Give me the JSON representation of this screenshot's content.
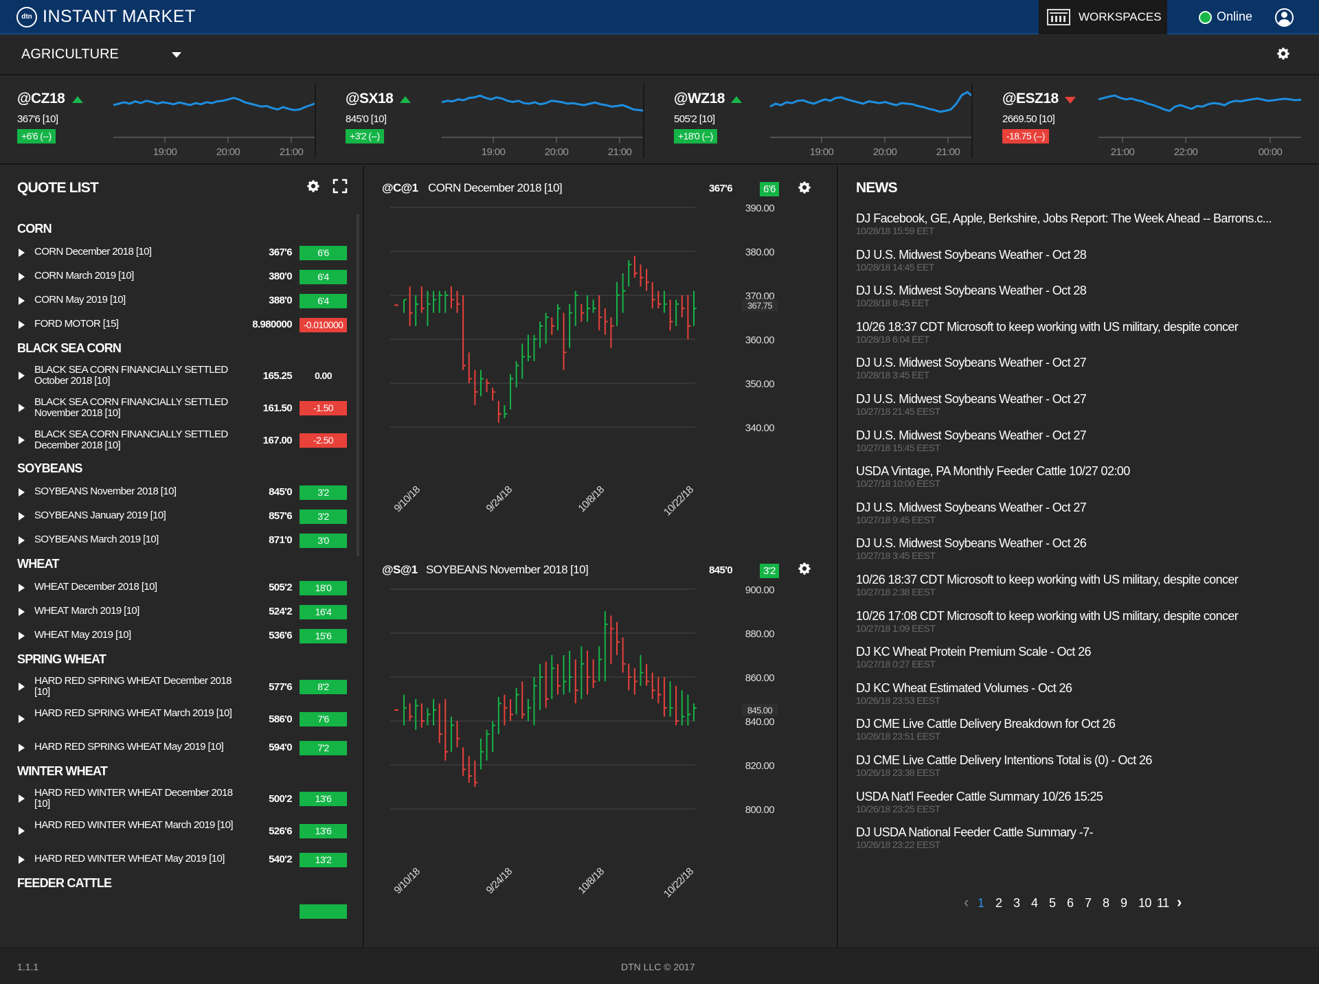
{
  "app": {
    "logo_text": "dtn",
    "title": "INSTANT MARKET"
  },
  "header": {
    "workspaces_label": "WORKSPACES",
    "status_label": "Online",
    "status_color": "#18b64a"
  },
  "workspace": {
    "selected": "AGRICULTURE"
  },
  "ticker": [
    {
      "symbol": "@CZ18",
      "direction": "up",
      "price": "367'6 [10]",
      "change": "+6'6 (--)",
      "change_sign": "pos",
      "times": [
        "19:00",
        "20:00",
        "21:00"
      ],
      "spark": [
        0.55,
        0.5,
        0.45,
        0.5,
        0.42,
        0.48,
        0.4,
        0.44,
        0.5,
        0.45,
        0.48,
        0.52,
        0.46,
        0.5,
        0.55,
        0.48,
        0.52,
        0.45,
        0.48,
        0.42,
        0.4,
        0.35,
        0.3,
        0.36,
        0.45,
        0.5,
        0.55,
        0.6,
        0.58,
        0.65,
        0.7,
        0.62,
        0.68,
        0.72,
        0.7,
        0.62,
        0.55,
        0.48
      ]
    },
    {
      "symbol": "@SX18",
      "direction": "up",
      "price": "845'0 [10]",
      "change": "+3'2 (--)",
      "change_sign": "pos",
      "times": [
        "19:00",
        "20:00",
        "21:00"
      ],
      "spark": [
        0.45,
        0.4,
        0.42,
        0.35,
        0.38,
        0.3,
        0.28,
        0.22,
        0.3,
        0.35,
        0.28,
        0.32,
        0.4,
        0.44,
        0.4,
        0.48,
        0.5,
        0.45,
        0.52,
        0.48,
        0.4,
        0.42,
        0.45,
        0.5,
        0.48,
        0.52,
        0.55,
        0.5,
        0.46,
        0.52,
        0.55,
        0.6,
        0.58,
        0.55,
        0.62,
        0.7,
        0.72,
        0.75
      ]
    },
    {
      "symbol": "@WZ18",
      "direction": "up",
      "price": "505'2 [10]",
      "change": "+18'0 (--)",
      "change_sign": "pos",
      "times": [
        "19:00",
        "20:00",
        "21:00"
      ],
      "spark": [
        0.6,
        0.5,
        0.55,
        0.45,
        0.48,
        0.4,
        0.38,
        0.45,
        0.5,
        0.42,
        0.35,
        0.4,
        0.3,
        0.28,
        0.35,
        0.4,
        0.45,
        0.5,
        0.42,
        0.45,
        0.48,
        0.44,
        0.5,
        0.55,
        0.48,
        0.5,
        0.52,
        0.58,
        0.62,
        0.68,
        0.72,
        0.78,
        0.75,
        0.7,
        0.5,
        0.2,
        0.1,
        0.25
      ]
    },
    {
      "symbol": "@ESZ18",
      "direction": "down",
      "price": "2669.50 [10]",
      "change": "-18.75 (--)",
      "change_sign": "neg",
      "times": [
        "21:00",
        "22:00",
        "00:00"
      ],
      "spark": [
        0.35,
        0.3,
        0.25,
        0.22,
        0.3,
        0.35,
        0.32,
        0.38,
        0.42,
        0.5,
        0.55,
        0.62,
        0.7,
        0.75,
        0.6,
        0.55,
        0.62,
        0.68,
        0.58,
        0.6,
        0.52,
        0.48,
        0.5,
        0.55,
        0.45,
        0.4,
        0.42,
        0.38,
        0.35,
        0.32,
        0.36,
        0.4,
        0.38,
        0.35,
        0.33,
        0.35,
        0.38,
        0.36
      ]
    }
  ],
  "quote_list": {
    "title": "QUOTE LIST",
    "groups": [
      {
        "name": "CORN",
        "rows": [
          {
            "name": "CORN December 2018 [10]",
            "last": "367'6",
            "change": "6'6",
            "sign": "pos"
          },
          {
            "name": "CORN March 2019 [10]",
            "last": "380'0",
            "change": "6'4",
            "sign": "pos"
          },
          {
            "name": "CORN May 2019 [10]",
            "last": "388'0",
            "change": "6'4",
            "sign": "pos"
          },
          {
            "name": "FORD MOTOR [15]",
            "last": "8.980000",
            "change": "-0.010000",
            "sign": "neg"
          }
        ]
      },
      {
        "name": "BLACK SEA CORN",
        "rows": [
          {
            "name": "BLACK SEA CORN FINANCIALLY SETTLED October 2018 [10]",
            "last": "165.25",
            "change": "0.00",
            "sign": "flat",
            "tall": true
          },
          {
            "name": "BLACK SEA CORN FINANCIALLY SETTLED November 2018 [10]",
            "last": "161.50",
            "change": "-1.50",
            "sign": "neg",
            "tall": true
          },
          {
            "name": "BLACK SEA CORN FINANCIALLY SETTLED December 2018 [10]",
            "last": "167.00",
            "change": "-2.50",
            "sign": "neg",
            "tall": true
          }
        ]
      },
      {
        "name": "SOYBEANS",
        "rows": [
          {
            "name": "SOYBEANS November 2018 [10]",
            "last": "845'0",
            "change": "3'2",
            "sign": "pos"
          },
          {
            "name": "SOYBEANS January 2019 [10]",
            "last": "857'6",
            "change": "3'2",
            "sign": "pos"
          },
          {
            "name": "SOYBEANS March 2019 [10]",
            "last": "871'0",
            "change": "3'0",
            "sign": "pos"
          }
        ]
      },
      {
        "name": "WHEAT",
        "rows": [
          {
            "name": "WHEAT December 2018 [10]",
            "last": "505'2",
            "change": "18'0",
            "sign": "pos"
          },
          {
            "name": "WHEAT March 2019 [10]",
            "last": "524'2",
            "change": "16'4",
            "sign": "pos"
          },
          {
            "name": "WHEAT May 2019 [10]",
            "last": "536'6",
            "change": "15'6",
            "sign": "pos"
          }
        ]
      },
      {
        "name": "SPRING WHEAT",
        "rows": [
          {
            "name": "HARD RED SPRING WHEAT December 2018 [10]",
            "last": "577'6",
            "change": "8'2",
            "sign": "pos",
            "tall": true
          },
          {
            "name": "HARD RED SPRING WHEAT March 2019 [10]",
            "last": "586'0",
            "change": "7'6",
            "sign": "pos",
            "tall": true
          },
          {
            "name": "HARD RED SPRING WHEAT May 2019 [10]",
            "last": "594'0",
            "change": "7'2",
            "sign": "pos"
          }
        ]
      },
      {
        "name": "WINTER WHEAT",
        "rows": [
          {
            "name": "HARD RED WINTER WHEAT December 2018 [10]",
            "last": "500'2",
            "change": "13'6",
            "sign": "pos",
            "tall": true
          },
          {
            "name": "HARD RED WINTER WHEAT March 2019 [10]",
            "last": "526'6",
            "change": "13'6",
            "sign": "pos",
            "tall": true
          },
          {
            "name": "HARD RED WINTER WHEAT May 2019 [10]",
            "last": "540'2",
            "change": "13'2",
            "sign": "pos"
          }
        ]
      },
      {
        "name": "FEEDER CATTLE",
        "rows": []
      }
    ]
  },
  "charts": [
    {
      "symbol": "@C@1",
      "name": "CORN December 2018 [10]",
      "last": "367'6",
      "change": "6'6",
      "sign": "pos"
    },
    {
      "symbol": "@S@1",
      "name": "SOYBEANS November 2018 [10]",
      "last": "845'0",
      "change": "3'2",
      "sign": "pos"
    }
  ],
  "chart_data": [
    {
      "type": "ohlc",
      "title": "@C@1 CORN December 2018 [10]",
      "ylim": [
        340,
        390
      ],
      "yticks": [
        "390.00",
        "380.00",
        "370.00",
        "360.00",
        "350.00",
        "340.00"
      ],
      "xticks": [
        "9/10/18",
        "9/24/18",
        "10/8/18",
        "10/22/18"
      ],
      "last_label": "367.75",
      "last_value": 367.75,
      "bars": [
        [
          369,
          366,
          369
        ],
        [
          372,
          363,
          366
        ],
        [
          370,
          363,
          368
        ],
        [
          372,
          366,
          367
        ],
        [
          371,
          363,
          368
        ],
        [
          371,
          366,
          369
        ],
        [
          371,
          366,
          370
        ],
        [
          371,
          366,
          370
        ],
        [
          372,
          367,
          369
        ],
        [
          371,
          366,
          368
        ],
        [
          370,
          353,
          354
        ],
        [
          357,
          350,
          351
        ],
        [
          353,
          345,
          348
        ],
        [
          353,
          347,
          351
        ],
        [
          351,
          348,
          350
        ],
        [
          349,
          346,
          348
        ],
        [
          346,
          341,
          343
        ],
        [
          345,
          342,
          343
        ],
        [
          352,
          344,
          351
        ],
        [
          355,
          349,
          354
        ],
        [
          359,
          351,
          356
        ],
        [
          361,
          355,
          356
        ],
        [
          361,
          355,
          360
        ],
        [
          364,
          358,
          363
        ],
        [
          366,
          359,
          365
        ],
        [
          365,
          361,
          363
        ],
        [
          368,
          362,
          367
        ],
        [
          366,
          353,
          357
        ],
        [
          368,
          358,
          366
        ],
        [
          371,
          363,
          370
        ],
        [
          368,
          364,
          366
        ],
        [
          370,
          364,
          367
        ],
        [
          369,
          366,
          367
        ],
        [
          370,
          362,
          365
        ],
        [
          367,
          361,
          364
        ],
        [
          365,
          358,
          363
        ],
        [
          373,
          363,
          370
        ],
        [
          375,
          366,
          371
        ],
        [
          378,
          372,
          377
        ],
        [
          379,
          374,
          375
        ],
        [
          377,
          372,
          374
        ],
        [
          376,
          371,
          373
        ],
        [
          373,
          367,
          369
        ],
        [
          371,
          367,
          368
        ],
        [
          371,
          366,
          368
        ],
        [
          369,
          362,
          364
        ],
        [
          369,
          363,
          368
        ],
        [
          370,
          365,
          367
        ],
        [
          370,
          360,
          363
        ],
        [
          371,
          363,
          367
        ]
      ]
    },
    {
      "type": "ohlc",
      "title": "@S@1 SOYBEANS November 2018 [10]",
      "ylim": [
        800,
        900
      ],
      "yticks": [
        "900.00",
        "880.00",
        "860.00",
        "840.00",
        "820.00",
        "800.00"
      ],
      "xticks": [
        "9/10/18",
        "9/24/18",
        "10/8/18",
        "10/22/18"
      ],
      "last_label": "845.00",
      "last_value": 845.0,
      "bars": [
        [
          852,
          838,
          846
        ],
        [
          848,
          840,
          842
        ],
        [
          850,
          836,
          847
        ],
        [
          848,
          837,
          840
        ],
        [
          846,
          838,
          843
        ],
        [
          850,
          838,
          845
        ],
        [
          848,
          830,
          834
        ],
        [
          850,
          822,
          826
        ],
        [
          842,
          826,
          838
        ],
        [
          840,
          828,
          832
        ],
        [
          828,
          815,
          818
        ],
        [
          824,
          812,
          815
        ],
        [
          822,
          810,
          812
        ],
        [
          832,
          818,
          826
        ],
        [
          836,
          822,
          834
        ],
        [
          840,
          826,
          838
        ],
        [
          851,
          834,
          848
        ],
        [
          852,
          838,
          846
        ],
        [
          850,
          840,
          843
        ],
        [
          855,
          843,
          852
        ],
        [
          858,
          841,
          843
        ],
        [
          850,
          840,
          846
        ],
        [
          860,
          838,
          856
        ],
        [
          866,
          845,
          860
        ],
        [
          867,
          846,
          850
        ],
        [
          870,
          850,
          864
        ],
        [
          866,
          852,
          856
        ],
        [
          870,
          852,
          858
        ],
        [
          872,
          853,
          860
        ],
        [
          868,
          848,
          854
        ],
        [
          874,
          850,
          866
        ],
        [
          872,
          852,
          860
        ],
        [
          868,
          855,
          858
        ],
        [
          874,
          858,
          868
        ],
        [
          890,
          858,
          884
        ],
        [
          888,
          866,
          882
        ],
        [
          885,
          870,
          876
        ],
        [
          878,
          862,
          866
        ],
        [
          866,
          854,
          860
        ],
        [
          864,
          852,
          858
        ],
        [
          870,
          856,
          862
        ],
        [
          866,
          856,
          858
        ],
        [
          862,
          850,
          854
        ],
        [
          860,
          848,
          852
        ],
        [
          860,
          842,
          846
        ],
        [
          858,
          842,
          846
        ],
        [
          856,
          838,
          840
        ],
        [
          854,
          838,
          842
        ],
        [
          852,
          838,
          843
        ],
        [
          848,
          840,
          846
        ]
      ]
    }
  ],
  "news": {
    "title": "NEWS",
    "items": [
      {
        "headline": "DJ Facebook, GE, Apple, Berkshire, Jobs Report: The Week Ahead -- Barrons.c...",
        "time": "10/28/18 15:59 EET"
      },
      {
        "headline": "DJ U.S. Midwest Soybeans Weather - Oct 28",
        "time": "10/28/18 14:45 EET"
      },
      {
        "headline": "DJ U.S. Midwest Soybeans Weather - Oct 28",
        "time": "10/28/18 8:45 EET"
      },
      {
        "headline": "10/26 18:37 CDT Microsoft to keep working with US military, despite concer",
        "time": "10/28/18 6:04 EET"
      },
      {
        "headline": "DJ U.S. Midwest Soybeans Weather - Oct 27",
        "time": "10/28/18 3:45 EET"
      },
      {
        "headline": "DJ U.S. Midwest Soybeans Weather - Oct 27",
        "time": "10/27/18 21:45 EEST"
      },
      {
        "headline": "DJ U.S. Midwest Soybeans Weather - Oct 27",
        "time": "10/27/18 15:45 EEST"
      },
      {
        "headline": "USDA Vintage, PA Monthly Feeder Cattle 10/27 02:00",
        "time": "10/27/18 10:00 EEST"
      },
      {
        "headline": "DJ U.S. Midwest Soybeans Weather - Oct 27",
        "time": "10/27/18 9:45 EEST"
      },
      {
        "headline": "DJ U.S. Midwest Soybeans Weather - Oct 26",
        "time": "10/27/18 3:45 EEST"
      },
      {
        "headline": "10/26 18:37 CDT Microsoft to keep working with US military, despite concer",
        "time": "10/27/18 2:38 EEST"
      },
      {
        "headline": "10/26 17:08 CDT Microsoft to keep working with US military, despite concer",
        "time": "10/27/18 1:09 EEST"
      },
      {
        "headline": "DJ KC Wheat Protein Premium Scale - Oct 26",
        "time": "10/27/18 0:27 EEST"
      },
      {
        "headline": "DJ KC Wheat Estimated Volumes - Oct 26",
        "time": "10/26/18 23:53 EEST"
      },
      {
        "headline": "DJ CME Live Cattle Delivery Breakdown for Oct 26",
        "time": "10/26/18 23:51 EEST"
      },
      {
        "headline": "DJ CME Live Cattle Delivery Intentions Total is (0) - Oct 26",
        "time": "10/26/18 23:38 EEST"
      },
      {
        "headline": "USDA Nat'l Feeder Cattle Summary 10/26 15:25",
        "time": "10/26/18 23:25 EEST"
      },
      {
        "headline": "DJ USDA National Feeder Cattle Summary -7-",
        "time": "10/26/18 23:22 EEST"
      }
    ],
    "pages": [
      "1",
      "2",
      "3",
      "4",
      "5",
      "6",
      "7",
      "8",
      "9",
      "10",
      "11"
    ],
    "current_page": "1"
  },
  "footer": {
    "version": "1.1.1",
    "copyright": "DTN LLC © 2017"
  },
  "colors": {
    "up": "#15b447",
    "down": "#e8413a",
    "spark": "#1d8fe0",
    "header": "#0a3366"
  }
}
